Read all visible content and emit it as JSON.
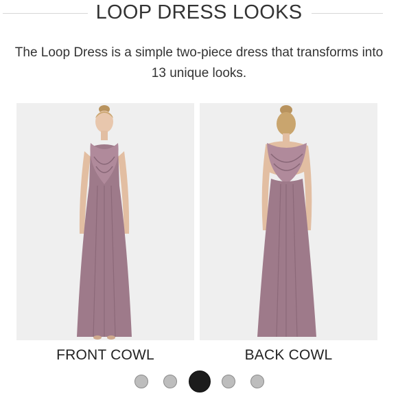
{
  "section": {
    "title": "LOOP DRESS LOOKS",
    "description": "The Loop Dress is a simple two-piece dress that transforms into 13 unique looks."
  },
  "looks": [
    {
      "caption": "FRONT COWL",
      "image": "model-front-cowl"
    },
    {
      "caption": "BACK COWL",
      "image": "model-back-cowl"
    }
  ],
  "carousel": {
    "total_pages": 5,
    "active_page": 3
  },
  "colors": {
    "dress": "#9e7a8a",
    "card_background": "#efefef",
    "dot_inactive": "#bdbdbd",
    "dot_active": "#1c1c1c"
  }
}
